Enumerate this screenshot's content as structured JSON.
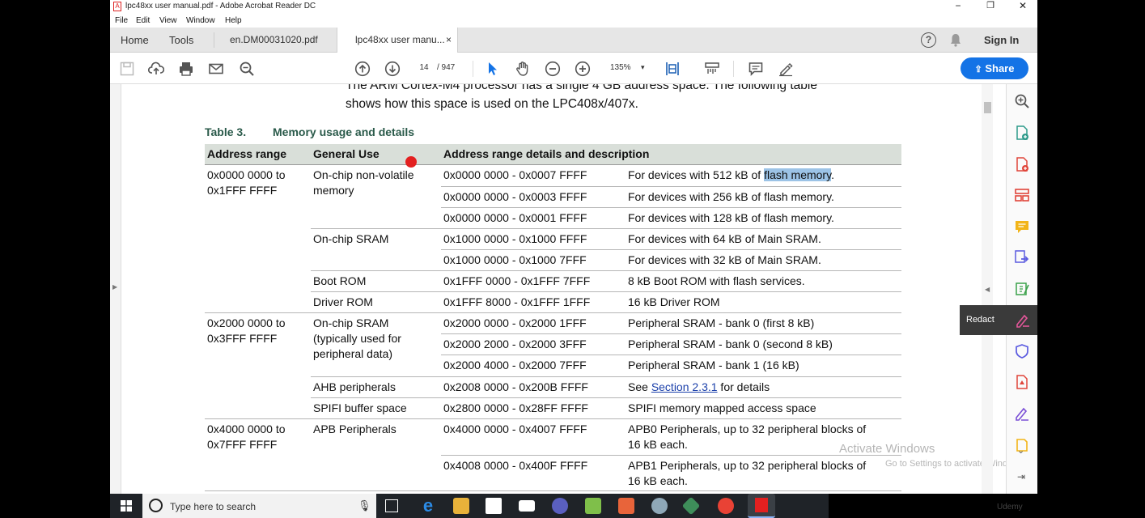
{
  "window": {
    "title": "lpc48xx user manual.pdf - Adobe Acrobat Reader DC",
    "minimize": "−",
    "maximize": "❐",
    "close": "✕"
  },
  "menu": [
    "File",
    "Edit",
    "View",
    "Window",
    "Help"
  ],
  "tabs": {
    "home": "Home",
    "tools": "Tools",
    "doc1": "en.DM00031020.pdf",
    "doc2": "lpc48xx user manu...",
    "close": "×",
    "help": "?",
    "signin": "Sign In"
  },
  "toolbar": {
    "page_current": "14",
    "page_total": "/ 947",
    "zoom": "135%",
    "share_label": "Share"
  },
  "right_panel": {
    "redact_label": "Redact"
  },
  "document": {
    "intro_line1": "The ARM Cortex-M4 processor has a single 4 GB address space. The following table",
    "intro_line2": "shows how this space is used on the LPC408x/407x.",
    "caption_num": "Table 3.",
    "caption_title": "Memory usage and details",
    "headers": [
      "Address range",
      "General Use",
      "Address range details and description"
    ],
    "ranges": [
      {
        "l1": "0x0000 0000 to",
        "l2": "0x1FFF FFFF"
      },
      {
        "l1": "0x2000 0000 to",
        "l2": "0x3FFF FFFF"
      },
      {
        "l1": "0x4000 0000 to",
        "l2": "0x7FFF FFFF"
      }
    ],
    "uses": [
      {
        "l1": "On-chip non-volatile",
        "l2": "memory"
      },
      {
        "l1": "On-chip SRAM"
      },
      {
        "l1": "Boot ROM"
      },
      {
        "l1": "Driver ROM"
      },
      {
        "l1": "On-chip SRAM",
        "l2": "(typically used for",
        "l3": "peripheral data)"
      },
      {
        "l1": "AHB peripherals"
      },
      {
        "l1": "SPIFI buffer space"
      },
      {
        "l1": "APB Peripherals"
      }
    ],
    "rows": [
      {
        "addr": "0x0000 0000 - 0x0007 FFFF",
        "pre": "For devices with 512 kB of ",
        "hl": "flash memory",
        "post": "."
      },
      {
        "addr": "0x0000 0000 - 0x0003 FFFF",
        "desc": "For devices with 256 kB of flash memory."
      },
      {
        "addr": "0x0000 0000 - 0x0001 FFFF",
        "desc": "For devices with 128 kB of flash memory."
      },
      {
        "addr": "0x1000 0000 - 0x1000 FFFF",
        "desc": "For devices with 64 kB of Main SRAM."
      },
      {
        "addr": "0x1000 0000 - 0x1000 7FFF",
        "desc": "For devices with 32 kB of Main SRAM."
      },
      {
        "addr": "0x1FFF 0000 - 0x1FFF 7FFF",
        "desc": "8 kB Boot ROM with flash services."
      },
      {
        "addr": "0x1FFF 8000 - 0x1FFF 1FFF",
        "desc": "16 kB Driver ROM"
      },
      {
        "addr": "0x2000 0000 - 0x2000 1FFF",
        "desc": "Peripheral SRAM - bank 0 (first 8 kB)"
      },
      {
        "addr": "0x2000 2000 - 0x2000 3FFF",
        "desc": "Peripheral SRAM - bank 0 (second 8 kB)"
      },
      {
        "addr": "0x2000 4000 - 0x2000 7FFF",
        "desc": "Peripheral SRAM - bank 1 (16 kB)"
      },
      {
        "addr": "0x2008 0000 - 0x200B FFFF",
        "pre": "See ",
        "link": "Section 2.3.1",
        "post": " for details"
      },
      {
        "addr": "0x2800 0000 - 0x28FF FFFF",
        "desc": "SPIFI memory mapped access space"
      },
      {
        "addr": "0x4000 0000 - 0x4007 FFFF",
        "desc": "APB0 Peripherals, up to 32 peripheral blocks of",
        "desc2": "16 kB each."
      },
      {
        "addr": "0x4008 0000 - 0x400F FFFF",
        "desc": "APB1 Peripherals, up to 32 peripheral blocks of",
        "desc2": "16 kB each."
      }
    ]
  },
  "watermark": {
    "line1": "Activate Windows",
    "line2": "Go to Settings to activate Windows."
  },
  "taskbar": {
    "search_placeholder": "Type here to search"
  },
  "overlay": {
    "brand": "Udemy"
  },
  "colors": {
    "share": "#1473e6",
    "caption": "#2a5a4a",
    "header_bg": "#d9dfd9",
    "highlight": "#9cc3e6",
    "link": "#1a3faa",
    "acrobat_red": "#e32020"
  }
}
